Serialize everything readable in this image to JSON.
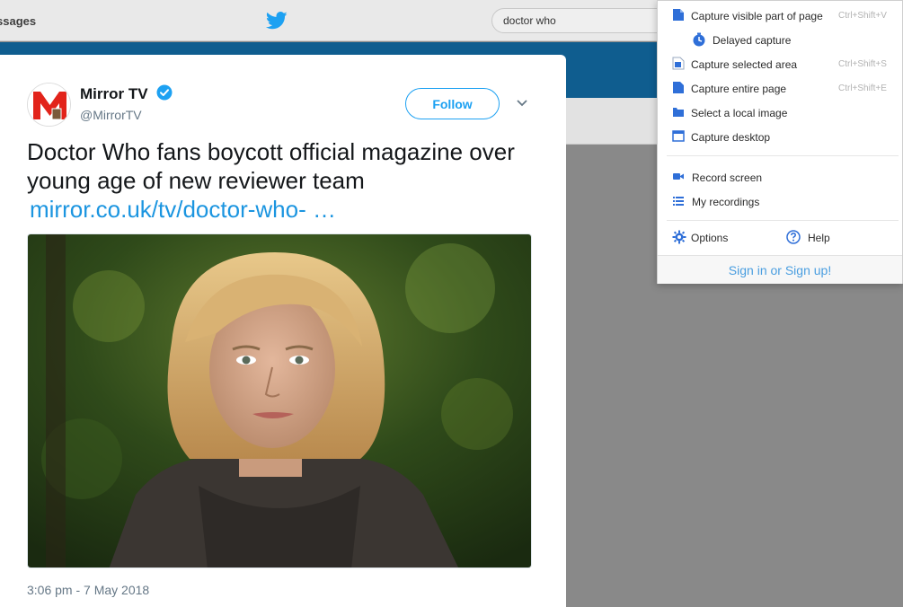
{
  "header": {
    "nav_label": "ssages",
    "search_value": "doctor who"
  },
  "tweet": {
    "author_name": "Mirror TV",
    "author_handle": "@MirrorTV",
    "follow_label": "Follow",
    "text": "Doctor Who fans boycott official magazine over young age of new reviewer team",
    "link": "mirror.co.uk/tv/doctor-who- …",
    "timestamp": "3:06 pm - 7 May 2018"
  },
  "popup": {
    "items": [
      {
        "label": "Capture visible part of page",
        "shortcut": "Ctrl+Shift+V",
        "icon": "page-icon"
      },
      {
        "label": "Delayed capture",
        "shortcut": "",
        "icon": "timer-icon"
      },
      {
        "label": "Capture selected area",
        "shortcut": "Ctrl+Shift+S",
        "icon": "selection-icon"
      },
      {
        "label": "Capture entire page",
        "shortcut": "Ctrl+Shift+E",
        "icon": "full-page-icon"
      },
      {
        "label": "Select a local image",
        "shortcut": "",
        "icon": "folder-icon"
      },
      {
        "label": "Capture desktop",
        "shortcut": "",
        "icon": "desktop-icon"
      },
      {
        "label": "Record screen",
        "shortcut": "",
        "icon": "video-camera-icon"
      },
      {
        "label": "My recordings",
        "shortcut": "",
        "icon": "list-icon"
      }
    ],
    "options_label": "Options",
    "help_label": "Help",
    "signin_label": "Sign in or Sign up!"
  },
  "colors": {
    "twitter_blue": "#1da1f2",
    "link_blue": "#1b95e0",
    "icon_blue": "#2f6fd8",
    "mirror_red": "#e2231a"
  }
}
